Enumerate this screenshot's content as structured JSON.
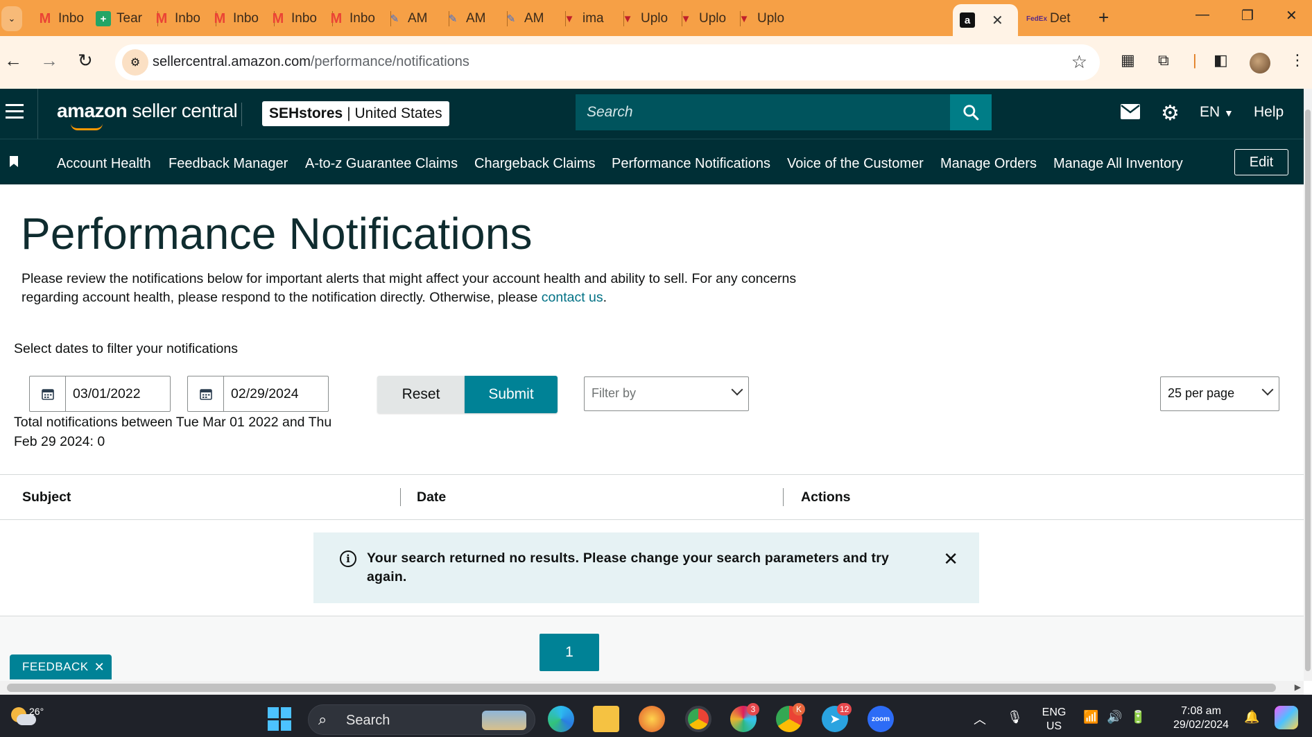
{
  "browser": {
    "tabs": [
      {
        "label": "Inbo",
        "icon": "gmail-icon"
      },
      {
        "label": "Tear",
        "icon": "sheets-icon"
      },
      {
        "label": "Inbo",
        "icon": "gmail-icon"
      },
      {
        "label": "Inbo",
        "icon": "gmail-icon"
      },
      {
        "label": "Inbo",
        "icon": "gmail-icon"
      },
      {
        "label": "Inbo",
        "icon": "gmail-icon"
      },
      {
        "label": "AM",
        "icon": "ai-pen-icon"
      },
      {
        "label": "AM",
        "icon": "ai-pen-icon"
      },
      {
        "label": "AM",
        "icon": "ai-pen-icon"
      },
      {
        "label": "ima",
        "icon": "shield-icon"
      },
      {
        "label": "Uplo",
        "icon": "shield-icon"
      },
      {
        "label": "Uplo",
        "icon": "shield-icon"
      },
      {
        "label": "Uplo",
        "icon": "shield-icon"
      },
      {
        "label": "",
        "icon": "amazon-icon"
      },
      {
        "label": "Det",
        "icon": "fedex-icon"
      }
    ],
    "url_domain": "sellercentral.amazon.com",
    "url_path": "/performance/notifications"
  },
  "header": {
    "logo_brand": "amazon",
    "logo_product": " seller central",
    "store_name": "SEHstores",
    "store_region": "| United States",
    "search_placeholder": "Search",
    "language": "EN",
    "help": "Help"
  },
  "nav": {
    "items": [
      "Account Health",
      "Feedback Manager",
      "A-to-z Guarantee Claims",
      "Chargeback Claims",
      "Performance Notifications",
      "Voice of the Customer",
      "Manage Orders",
      "Manage All Inventory"
    ],
    "edit": "Edit"
  },
  "page": {
    "title": "Performance Notifications",
    "intro": "Please review the notifications below for important alerts that might affect your account health and ability to sell. For any concerns regarding account health, please respond to the notification directly. Otherwise, please ",
    "intro_link": "contact us",
    "intro_end": ".",
    "filter_label": "Select dates to filter your notifications",
    "start_date": "03/01/2022",
    "end_date": "02/29/2024",
    "reset": "Reset",
    "submit": "Submit",
    "filter_by": "Filter by",
    "per_page": "25 per page",
    "total": "Total notifications between Tue Mar 01 2022 and Thu Feb 29 2024: 0"
  },
  "table": {
    "columns": [
      "Subject",
      "Date",
      "Actions"
    ],
    "empty_message": "Your search returned no results. Please change your search parameters and try again.",
    "current_page": "1"
  },
  "feedback": "FEEDBACK",
  "taskbar": {
    "temperature": "26°",
    "search": "Search",
    "slack_badge": "3",
    "chrome_badge": "K",
    "telegram_badge": "12",
    "zoom": "zoom",
    "lang_top": "ENG",
    "lang_bottom": "US",
    "time": "7:08 am",
    "date": "29/02/2024"
  },
  "colors": {
    "header_bg": "#002f36",
    "teal_button": "#008296",
    "link": "#007185",
    "alert_bg": "#e6f2f4",
    "tabstrip": "#f6a046"
  }
}
